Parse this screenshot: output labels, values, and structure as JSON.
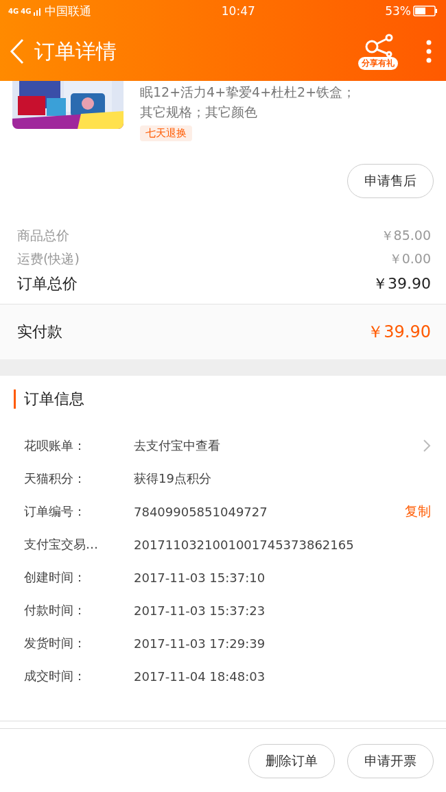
{
  "status_bar": {
    "network": [
      "4G",
      "4G"
    ],
    "carrier": "中国联通",
    "time": "10:47",
    "battery": "53%"
  },
  "header": {
    "title": "订单详情",
    "share_badge": "分享有礼"
  },
  "product": {
    "kind": "picture",
    "spec_lines": [
      "眠12+活力4+挚爱4+杜杜2+铁盒；",
      "其它规格；其它颜色"
    ],
    "tag": "七天退换",
    "after_sale_button": "申请售后"
  },
  "prices": [
    {
      "kind": "sub",
      "label": "商品总价",
      "value": "￥85.00"
    },
    {
      "kind": "sub",
      "label": "运费(快递)",
      "value": "￥0.00"
    },
    {
      "kind": "total",
      "label": "订单总价",
      "value": "￥39.90"
    }
  ],
  "paid": {
    "label": "实付款",
    "value": "￥39.90"
  },
  "order_info": {
    "title": "订单信息",
    "rows": [
      {
        "label": "花呗账单：",
        "value": "去支付宝中查看",
        "arrow": true
      },
      {
        "label": "天猫积分：",
        "value": "获得19点积分",
        "arrow": false
      },
      {
        "label": "订单编号：",
        "value": "78409905851049727",
        "arrow": false,
        "action": "复制"
      },
      {
        "label": "支付宝交易…",
        "value": "2017110321001001745373862165",
        "arrow": false
      },
      {
        "label": "创建时间：",
        "value": "2017-11-03 15:37:10",
        "arrow": false
      },
      {
        "label": "付款时间：",
        "value": "2017-11-03 15:37:23",
        "arrow": false
      },
      {
        "label": "发货时间：",
        "value": "2017-11-03 17:29:39",
        "arrow": false
      },
      {
        "label": "成交时间：",
        "value": "2017-11-04 18:48:03",
        "arrow": false
      }
    ]
  },
  "bottom_buttons": [
    "删除订单",
    "申请开票"
  ]
}
